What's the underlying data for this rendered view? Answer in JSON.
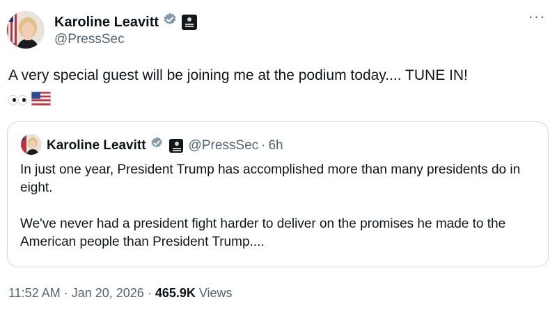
{
  "author": {
    "name": "Karoline Leavitt",
    "handle": "@PressSec",
    "verified_icon": "verified-badge-icon",
    "affiliation_icon": "white-house-affiliation-icon"
  },
  "more_icon": "more-horizontal-icon",
  "tweet": {
    "text": "A very special guest will be joining me at the podium today.... TUNE IN!",
    "emojis": [
      "eyes-emoji",
      "us-flag-emoji"
    ]
  },
  "quote": {
    "name": "Karoline Leavitt",
    "handle": "@PressSec",
    "separator": "·",
    "time": "6h",
    "paragraphs": [
      "In just one year, President Trump has accomplished more than many presidents do in eight.",
      "We've never had a president fight harder to deliver on the promises he made to the American people than President Trump...."
    ]
  },
  "meta": {
    "time": "11:52 AM",
    "sep1": " · ",
    "date": "Jan 20, 2026",
    "sep2": " · ",
    "views_count": "465.9K",
    "views_label": " Views"
  },
  "colors": {
    "text": "#0f1419",
    "secondary": "#536471",
    "verified": "#829aab",
    "border": "#cfd9de"
  }
}
